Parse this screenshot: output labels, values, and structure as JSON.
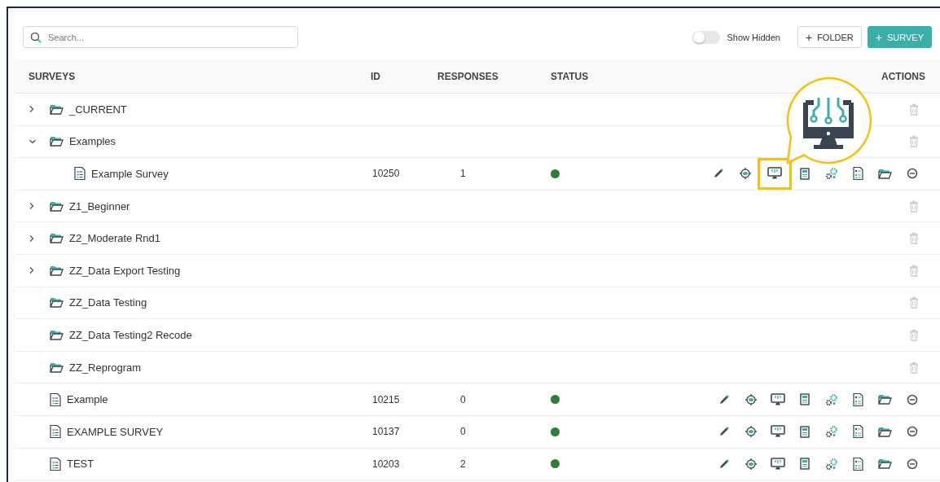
{
  "toolbar": {
    "search": {
      "placeholder": "Search..."
    },
    "show_hidden": {
      "label": "Show Hidden",
      "on": false
    },
    "buttons": [
      {
        "kind": "outline",
        "icon": "+",
        "label": "FOLDER"
      },
      {
        "kind": "primary",
        "icon": "+",
        "label": "SURVEY"
      }
    ]
  },
  "table": {
    "columns": [
      "SURVEYS",
      "ID",
      "RESPONSES",
      "STATUS",
      "ACTIONS"
    ],
    "rows": [
      {
        "kind": "folder",
        "name": "_CURRENT",
        "expanded": false
      },
      {
        "kind": "folder",
        "name": "Examples",
        "expanded": true,
        "children": [
          {
            "kind": "survey",
            "name": "Example Survey",
            "id": "10250",
            "responses": "1",
            "color": "#2e7d32",
            "actions": [
              {
                "kind": "edit",
                "highlighted": false
              },
              {
                "kind": "target",
                "highlighted": false
              },
              {
                "kind": "monitor",
                "highlighted": true
              },
              {
                "kind": "calculator",
                "highlighted": false
              },
              {
                "kind": "gears",
                "highlighted": false
              },
              {
                "kind": "report",
                "highlighted": false
              },
              {
                "kind": "folder",
                "highlighted": false
              },
              {
                "kind": "remove",
                "highlighted": false
              }
            ]
          }
        ]
      },
      {
        "kind": "folder",
        "name": "Z1_Beginner",
        "expanded": false
      },
      {
        "kind": "folder",
        "name": "Z2_Moderate Rnd1",
        "expanded": false
      },
      {
        "kind": "folder",
        "name": "ZZ_Data Export Testing",
        "expanded": false
      },
      {
        "kind": "folder",
        "name": "ZZ_Data Testing"
      },
      {
        "kind": "folder",
        "name": "ZZ_Data Testing2 Recode"
      },
      {
        "kind": "folder",
        "name": "ZZ_Reprogram"
      },
      {
        "kind": "survey",
        "name": "Example",
        "id": "10215",
        "responses": "0",
        "color": "#2e7d32",
        "actions": [
          {
            "kind": "edit",
            "highlighted": false
          },
          {
            "kind": "target",
            "highlighted": false
          },
          {
            "kind": "monitor",
            "highlighted": false
          },
          {
            "kind": "calculator",
            "highlighted": false
          },
          {
            "kind": "gears",
            "highlighted": false
          },
          {
            "kind": "report",
            "highlighted": false
          },
          {
            "kind": "folder",
            "highlighted": false
          },
          {
            "kind": "remove",
            "highlighted": false
          }
        ]
      },
      {
        "kind": "survey",
        "name": "EXAMPLE SURVEY",
        "id": "10137",
        "responses": "0",
        "color": "#2e7d32",
        "actions": [
          {
            "kind": "edit",
            "highlighted": false
          },
          {
            "kind": "target",
            "highlighted": false
          },
          {
            "kind": "monitor",
            "highlighted": false
          },
          {
            "kind": "calculator",
            "highlighted": false
          },
          {
            "kind": "gears",
            "highlighted": false
          },
          {
            "kind": "report",
            "highlighted": false
          },
          {
            "kind": "folder",
            "highlighted": false
          },
          {
            "kind": "remove",
            "highlighted": false
          }
        ]
      },
      {
        "kind": "survey",
        "name": "TEST",
        "id": "10203",
        "responses": "2",
        "color": "#2e7d32",
        "actions": [
          {
            "kind": "edit",
            "highlighted": false
          },
          {
            "kind": "target",
            "highlighted": false
          },
          {
            "kind": "monitor",
            "highlighted": false
          },
          {
            "kind": "calculator",
            "highlighted": false
          },
          {
            "kind": "gears",
            "highlighted": false
          },
          {
            "kind": "report",
            "highlighted": false
          },
          {
            "kind": "folder",
            "highlighted": false
          },
          {
            "kind": "remove",
            "highlighted": false
          }
        ]
      }
    ]
  }
}
